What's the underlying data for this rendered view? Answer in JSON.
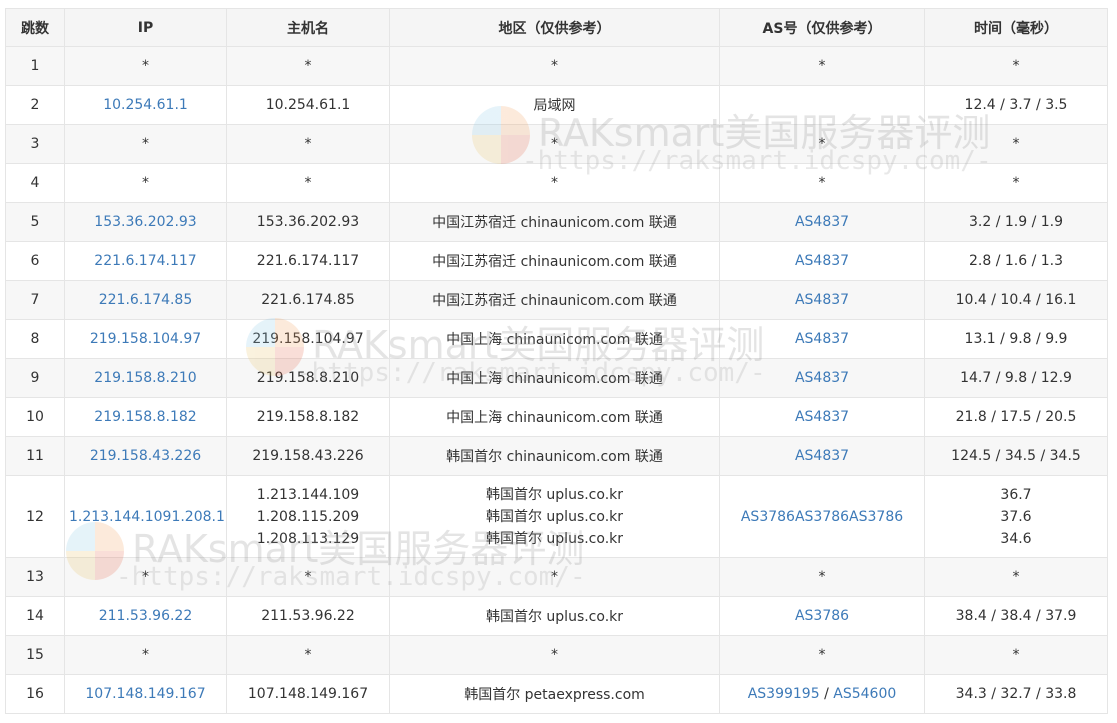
{
  "headers": [
    "跳数",
    "IP",
    "主机名",
    "地区（仅供参考）",
    "AS号（仅供参考）",
    "时间（毫秒）"
  ],
  "rows": [
    {
      "hop": "1",
      "ips": [
        "*"
      ],
      "hosts": [
        "*"
      ],
      "regions": [
        "*"
      ],
      "as_list": [
        "*"
      ],
      "times": [
        "*"
      ]
    },
    {
      "hop": "2",
      "ips": [
        "10.254.61.1"
      ],
      "hosts": [
        "10.254.61.1"
      ],
      "regions": [
        "局域网"
      ],
      "as_list": [
        ""
      ],
      "times": [
        "12.4 / 3.7 / 3.5"
      ]
    },
    {
      "hop": "3",
      "ips": [
        "*"
      ],
      "hosts": [
        "*"
      ],
      "regions": [
        "*"
      ],
      "as_list": [
        "*"
      ],
      "times": [
        "*"
      ]
    },
    {
      "hop": "4",
      "ips": [
        "*"
      ],
      "hosts": [
        "*"
      ],
      "regions": [
        "*"
      ],
      "as_list": [
        "*"
      ],
      "times": [
        "*"
      ]
    },
    {
      "hop": "5",
      "ips": [
        "153.36.202.93"
      ],
      "hosts": [
        "153.36.202.93"
      ],
      "regions": [
        "中国江苏宿迁 chinaunicom.com 联通"
      ],
      "as_list": [
        "AS4837"
      ],
      "times": [
        "3.2 / 1.9 / 1.9"
      ]
    },
    {
      "hop": "6",
      "ips": [
        "221.6.174.117"
      ],
      "hosts": [
        "221.6.174.117"
      ],
      "regions": [
        "中国江苏宿迁 chinaunicom.com 联通"
      ],
      "as_list": [
        "AS4837"
      ],
      "times": [
        "2.8 / 1.6 / 1.3"
      ]
    },
    {
      "hop": "7",
      "ips": [
        "221.6.174.85"
      ],
      "hosts": [
        "221.6.174.85"
      ],
      "regions": [
        "中国江苏宿迁 chinaunicom.com 联通"
      ],
      "as_list": [
        "AS4837"
      ],
      "times": [
        "10.4 / 10.4 / 16.1"
      ]
    },
    {
      "hop": "8",
      "ips": [
        "219.158.104.97"
      ],
      "hosts": [
        "219.158.104.97"
      ],
      "regions": [
        "中国上海 chinaunicom.com 联通"
      ],
      "as_list": [
        "AS4837"
      ],
      "times": [
        "13.1 / 9.8 / 9.9"
      ]
    },
    {
      "hop": "9",
      "ips": [
        "219.158.8.210"
      ],
      "hosts": [
        "219.158.8.210"
      ],
      "regions": [
        "中国上海 chinaunicom.com 联通"
      ],
      "as_list": [
        "AS4837"
      ],
      "times": [
        "14.7 / 9.8 / 12.9"
      ]
    },
    {
      "hop": "10",
      "ips": [
        "219.158.8.182"
      ],
      "hosts": [
        "219.158.8.182"
      ],
      "regions": [
        "中国上海 chinaunicom.com 联通"
      ],
      "as_list": [
        "AS4837"
      ],
      "times": [
        "21.8 / 17.5 / 20.5"
      ]
    },
    {
      "hop": "11",
      "ips": [
        "219.158.43.226"
      ],
      "hosts": [
        "219.158.43.226"
      ],
      "regions": [
        "韩国首尔 chinaunicom.com 联通"
      ],
      "as_list": [
        "AS4837"
      ],
      "times": [
        "124.5 / 34.5 / 34.5"
      ]
    },
    {
      "hop": "12",
      "ips": [
        "1.213.144.109",
        "1.208.115.209",
        "1.208.113.129"
      ],
      "hosts": [
        "1.213.144.109",
        "1.208.115.209",
        "1.208.113.129"
      ],
      "regions": [
        "韩国首尔 uplus.co.kr",
        "韩国首尔 uplus.co.kr",
        "韩国首尔 uplus.co.kr"
      ],
      "as_list": [
        "AS3786",
        "AS3786",
        "AS3786"
      ],
      "times": [
        "36.7",
        "37.6",
        "34.6"
      ]
    },
    {
      "hop": "13",
      "ips": [
        "*"
      ],
      "hosts": [
        "*"
      ],
      "regions": [
        "*"
      ],
      "as_list": [
        "*"
      ],
      "times": [
        "*"
      ]
    },
    {
      "hop": "14",
      "ips": [
        "211.53.96.22"
      ],
      "hosts": [
        "211.53.96.22"
      ],
      "regions": [
        "韩国首尔 uplus.co.kr"
      ],
      "as_list": [
        "AS3786"
      ],
      "times": [
        "38.4 / 38.4 / 37.9"
      ]
    },
    {
      "hop": "15",
      "ips": [
        "*"
      ],
      "hosts": [
        "*"
      ],
      "regions": [
        "*"
      ],
      "as_list": [
        "*"
      ],
      "times": [
        "*"
      ]
    },
    {
      "hop": "16",
      "ips": [
        "107.148.149.167"
      ],
      "hosts": [
        "107.148.149.167"
      ],
      "regions": [
        "韩国首尔 petaexpress.com"
      ],
      "as_list": [
        "AS399195 / AS54600"
      ],
      "times": [
        "34.3 / 32.7 / 33.8"
      ]
    }
  ],
  "watermark": {
    "title": "RAKsmart美国服务器评测",
    "url": "-https://raksmart.idcspy.com/-"
  },
  "colors": {
    "link": "#3d7ab8",
    "header_bg": "#f5f5f5",
    "stripe_bg": "#f7f7f7",
    "border": "#e5e5e5",
    "text": "#333333"
  }
}
